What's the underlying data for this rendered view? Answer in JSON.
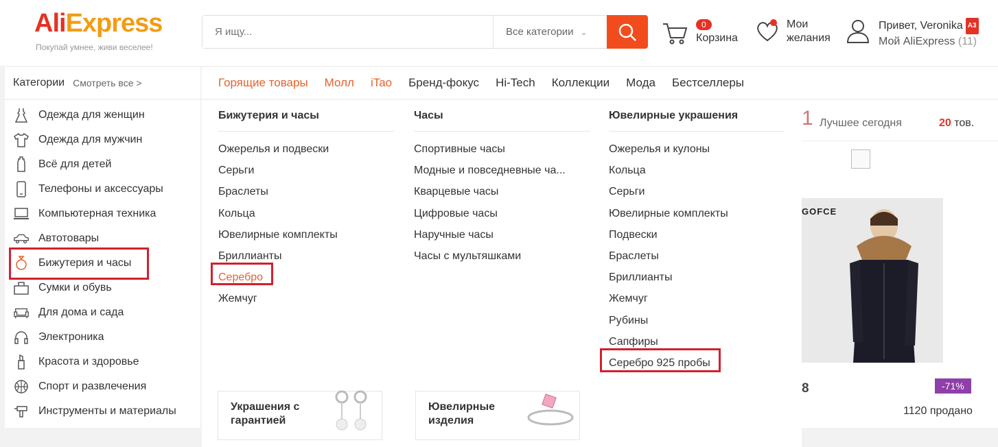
{
  "header": {
    "logo_ali": "Ali",
    "logo_express": "Express",
    "slogan": "Покупай умнее, живи веселее!",
    "search_placeholder": "Я ищу...",
    "search_category": "Все категории",
    "cart_count": "0",
    "cart_label": "Корзина",
    "wishlist_label": "Мои желания",
    "greeting": "Привет, Veronika",
    "account_badge": "A3",
    "my_account": "Мой AliExpress",
    "my_account_count": "(11)"
  },
  "nav": {
    "categories": "Категории",
    "see_all": "Смотреть все >",
    "top_links": [
      {
        "label": "Горящие товары"
      },
      {
        "label": "Молл"
      },
      {
        "label": "iTao"
      },
      {
        "label": "Бренд-фокус"
      },
      {
        "label": "Hi-Tech"
      },
      {
        "label": "Коллекции"
      },
      {
        "label": "Мода"
      },
      {
        "label": "Бестселлеры"
      }
    ]
  },
  "sidebar": {
    "items": [
      {
        "label": "Одежда для женщин",
        "icon": "dress-icon"
      },
      {
        "label": "Одежда для мужчин",
        "icon": "shirt-icon"
      },
      {
        "label": "Всё для детей",
        "icon": "baby-bottle-icon"
      },
      {
        "label": "Телефоны и аксессуары",
        "icon": "phone-icon"
      },
      {
        "label": "Компьютерная техника",
        "icon": "laptop-icon"
      },
      {
        "label": "Автотовары",
        "icon": "car-icon"
      },
      {
        "label": "Бижутерия и часы",
        "icon": "ring-icon"
      },
      {
        "label": "Сумки и обувь",
        "icon": "bag-icon"
      },
      {
        "label": "Для дома и сада",
        "icon": "sofa-icon"
      },
      {
        "label": "Электроника",
        "icon": "headphones-icon"
      },
      {
        "label": "Красота и здоровье",
        "icon": "lipstick-icon"
      },
      {
        "label": "Спорт и развлечения",
        "icon": "ball-icon"
      },
      {
        "label": "Инструменты и материалы",
        "icon": "drill-icon"
      }
    ]
  },
  "dropdown": {
    "col1": {
      "title": "Бижутерия и часы",
      "items": [
        "Ожерелья и подвески",
        "Серьги",
        "Браслеты",
        "Кольца",
        "Ювелирные комплекты",
        "Бриллианты",
        "Серебро",
        "Жемчуг"
      ]
    },
    "col2": {
      "title": "Часы",
      "items": [
        "Спортивные часы",
        "Модные и повседневные ча...",
        "Кварцевые часы",
        "Цифровые часы",
        "Наручные часы",
        "Часы с мультяшками"
      ]
    },
    "col3": {
      "title": "Ювелирные украшения",
      "items": [
        "Ожерелья и кулоны",
        "Кольца",
        "Серьги",
        "Ювелирные комплекты",
        "Подвески",
        "Браслеты",
        "Бриллианты",
        "Жемчуг",
        "Рубины",
        "Сапфиры",
        "Серебро 925 пробы"
      ]
    },
    "promo1": "Украшения с гарантией",
    "promo2": "Ювелирные изделия"
  },
  "product": {
    "big_char": "1",
    "best_today": "Лучшее сегодня",
    "count_num": "20",
    "count_unit": "тов.",
    "brand": "GOFCE",
    "price_part": "8",
    "discount": "-71%",
    "sold": "1120 продано"
  },
  "colors": {
    "accent": "#e43225",
    "orange": "#e8602c",
    "highlight": "#d0202e",
    "discount": "#8e3fa8"
  }
}
